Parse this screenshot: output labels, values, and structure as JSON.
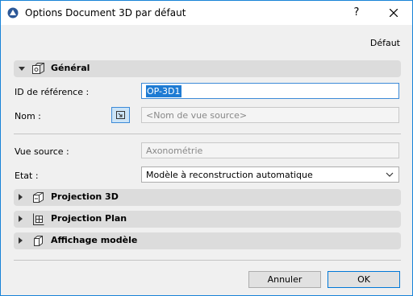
{
  "window": {
    "title": "Options Document 3D par défaut"
  },
  "titlebar": {
    "help": "?"
  },
  "preset": {
    "label": "Défaut"
  },
  "sections": {
    "general": {
      "label": "Général",
      "expanded": true
    },
    "projection3d": {
      "label": "Projection 3D",
      "expanded": false
    },
    "projectionPlan": {
      "label": "Projection Plan",
      "expanded": false
    },
    "affichage": {
      "label": "Affichage modèle",
      "expanded": false
    }
  },
  "fields": {
    "ref_id": {
      "label": "ID de référence :",
      "value": "OP-3D1"
    },
    "nom": {
      "label": "Nom :",
      "placeholder": "<Nom de vue source>"
    },
    "vue_source": {
      "label": "Vue source :",
      "value": "Axonométrie"
    },
    "etat": {
      "label": "Etat :",
      "value": "Modèle à reconstruction automatique"
    }
  },
  "buttons": {
    "cancel": "Annuler",
    "ok": "OK"
  },
  "colors": {
    "accent": "#0078d7",
    "selection": "#1e7bd3",
    "section_bg": "#dcdcdc"
  }
}
